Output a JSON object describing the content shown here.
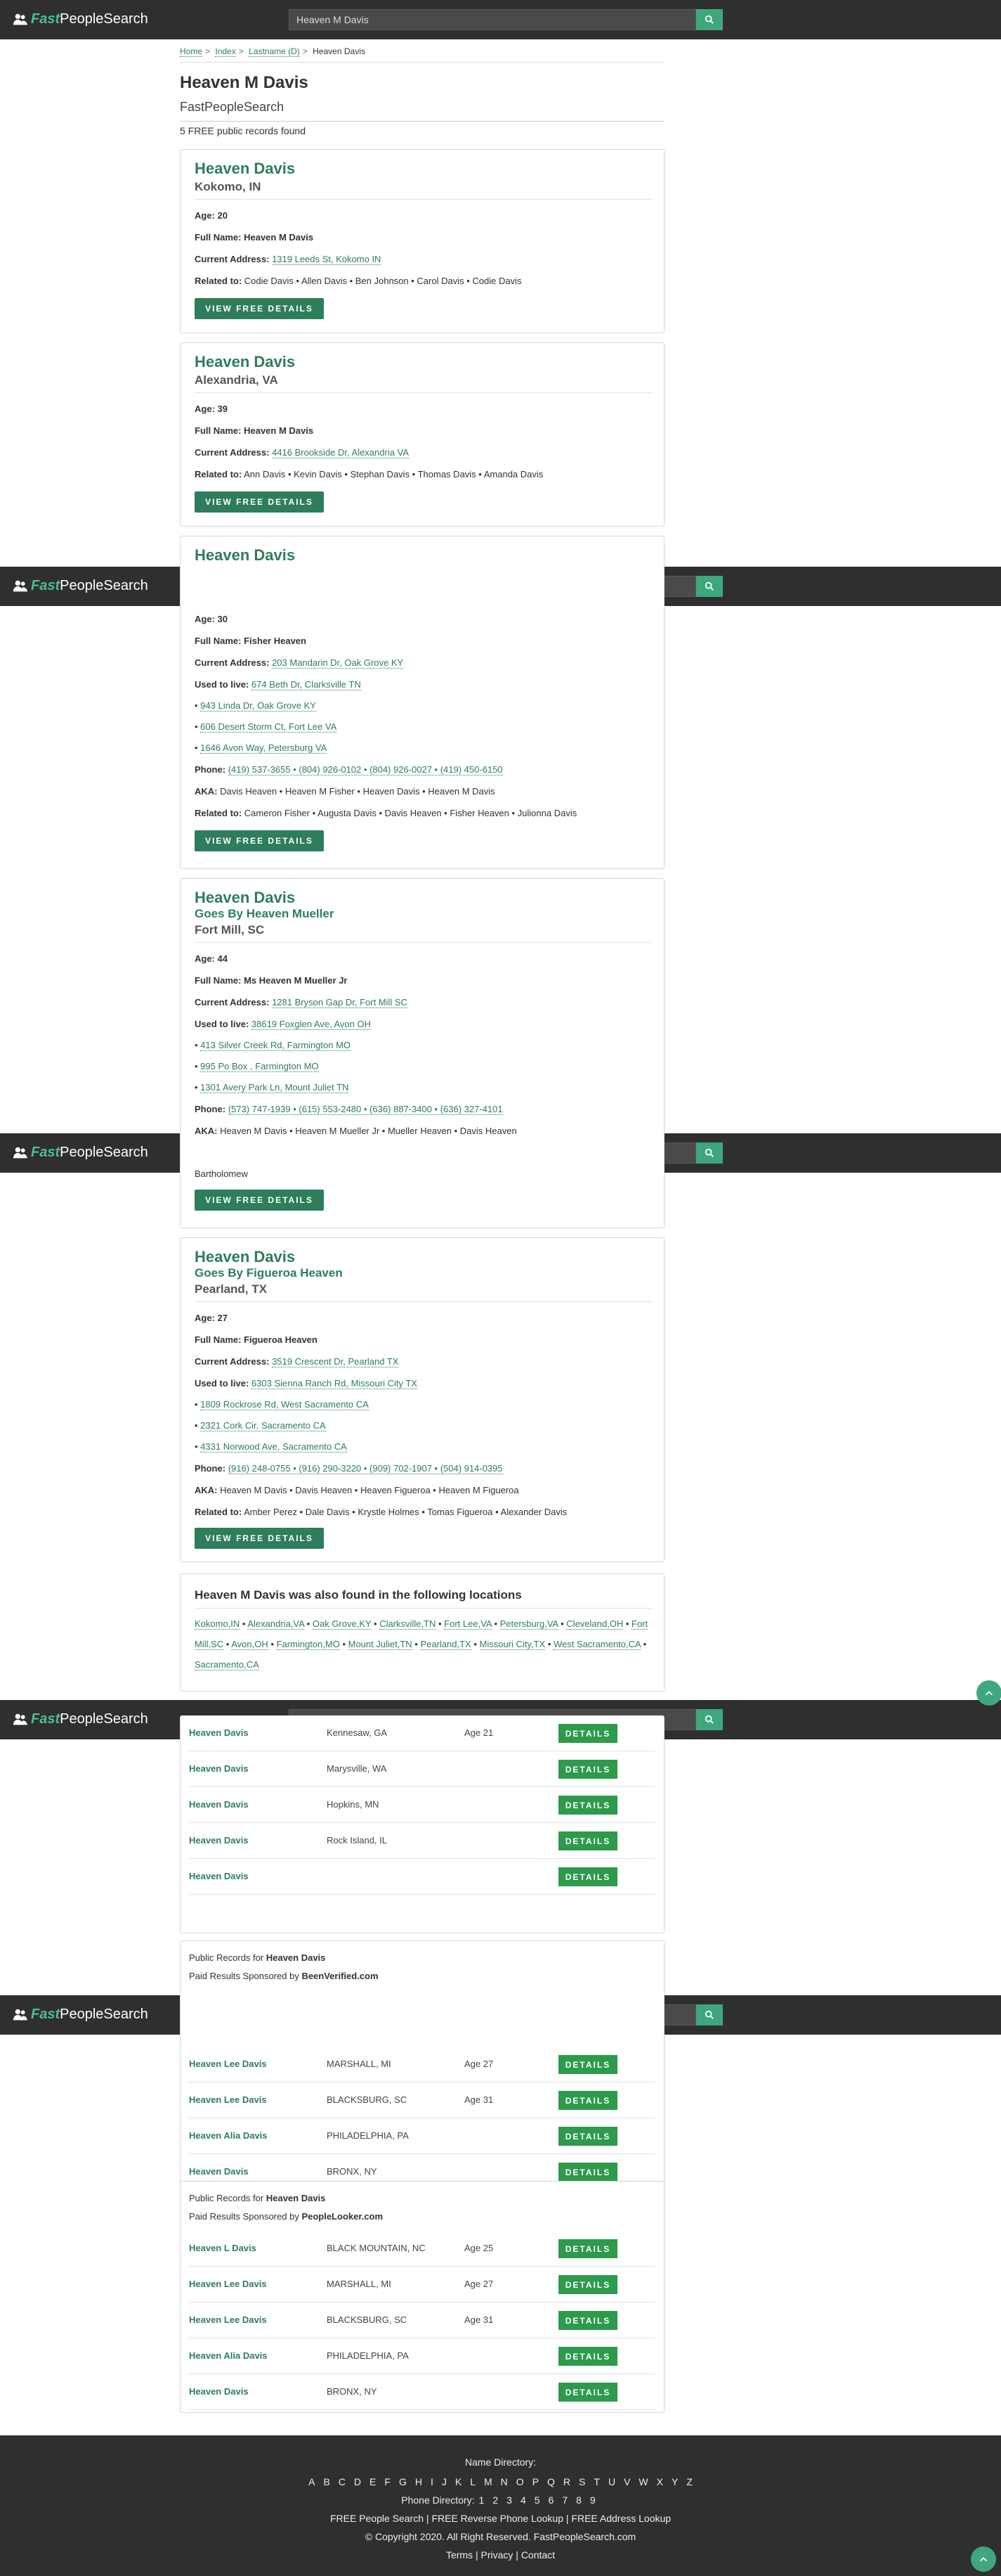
{
  "header": {
    "logo_fast": "Fast",
    "logo_rest": "PeopleSearch",
    "search_value": "Heaven M Davis"
  },
  "breadcrumb": [
    "Home",
    "Index",
    "Lastname (D)",
    "Heaven Davis"
  ],
  "page_title": "Heaven M Davis",
  "subtitle": "FastPeopleSearch",
  "result_count": "5 FREE public records found",
  "labels": {
    "age": "Age:",
    "full_name": "Full Name:",
    "current_address": "Current Address:",
    "used_to_live": "Used to live:",
    "phone": "Phone:",
    "aka": "AKA:",
    "related_to": "Related to:",
    "goes_by": "Goes By",
    "view_button": "VIEW FREE DETAILS",
    "details_button": "DETAILS"
  },
  "records": [
    {
      "name": "Heaven Davis",
      "location": "Kokomo, IN",
      "age": "20",
      "full_name": "Heaven M Davis",
      "current_address": "1319 Leeds St, Kokomo IN",
      "related": "Codie Davis • Allen Davis • Ben Johnson • Carol Davis • Codie Davis"
    },
    {
      "name": "Heaven Davis",
      "location": "Alexandria, VA",
      "age": "39",
      "full_name": "Heaven M Davis",
      "current_address": "4416 Brookside Dr, Alexandria VA",
      "related": "Ann Davis • Kevin Davis • Stephan Davis • Thomas Davis • Amanda Davis"
    },
    {
      "name": "Heaven Davis",
      "age": "30",
      "full_name": "Fisher Heaven",
      "current_address": "203 Mandarin Dr, Oak Grove KY",
      "used_to_live": [
        "674 Beth Dr, Clarksville TN",
        "943 Linda Dr, Oak Grove KY",
        "606 Desert Storm Ct, Fort Lee VA",
        "1646 Avon Way, Petersburg VA"
      ],
      "phones": "(419) 537-3655 • (804) 926-0102 • (804) 926-0027 • (419) 450-6150",
      "aka": "Davis Heaven • Heaven M Fisher • Heaven Davis • Heaven M Davis",
      "related": "Cameron Fisher • Augusta Davis • Davis Heaven • Fisher Heaven • Julionna Davis"
    },
    {
      "name": "Heaven Davis",
      "goes_by": "Heaven Mueller",
      "location": "Fort Mill, SC",
      "age": "44",
      "full_name": "Ms Heaven M Mueller Jr",
      "current_address": "1281 Bryson Gap Dr, Fort Mill SC",
      "used_to_live": [
        "38619 Foxglen Ave, Avon OH",
        "413 Silver Creek Rd, Farmington MO",
        "995 Po Box , Farmington MO",
        "1301 Avery Park Ln, Mount Juliet TN"
      ],
      "phones": "(573) 747-1939 • (615) 553-2480 • (636) 887-3400 • (636) 327-4101",
      "aka": "Heaven M Davis • Heaven M Mueller Jr • Mueller Heaven • Davis Heaven",
      "related_tail": "Bartholomew"
    },
    {
      "name": "Heaven Davis",
      "goes_by": "Figueroa Heaven",
      "location": "Pearland, TX",
      "age": "27",
      "full_name": "Figueroa Heaven",
      "current_address": "3519 Crescent Dr, Pearland TX",
      "used_to_live": [
        "6303 Sienna Ranch Rd, Missouri City TX",
        "1809 Rockrose Rd, West Sacramento CA",
        "2321 Cork Cir, Sacramento CA",
        "4331 Norwood Ave, Sacramento CA"
      ],
      "phones": "(916) 248-0755 • (916) 290-3220 • (909) 702-1907 • (504) 914-0395",
      "aka": "Heaven M Davis • Davis Heaven • Heaven Figueroa • Heaven M Figueroa",
      "related": "Amber Perez • Dale Davis • Krystle Holmes • Tomas Figueroa • Alexander Davis"
    }
  ],
  "locations": {
    "title": "Heaven M Davis was also found in the following locations",
    "items": [
      "Kokomo,IN",
      "Alexandria,VA",
      "Oak Grove,KY",
      "Clarksville,TN",
      "Fort Lee,VA",
      "Petersburg,VA",
      "Cleveland,OH",
      "Fort Mill,SC",
      "Avon,OH",
      "Farmington,MO",
      "Mount Juliet,TN",
      "Pearland,TX",
      "Missouri City,TX",
      "West Sacramento,CA",
      "Sacramento,CA"
    ]
  },
  "table1": [
    {
      "name": "Heaven Davis",
      "city": "Kennesaw, GA",
      "age": "Age 21"
    },
    {
      "name": "Heaven Davis",
      "city": "Marysville, WA",
      "age": ""
    },
    {
      "name": "Heaven Davis",
      "city": "Hopkins, MN",
      "age": ""
    },
    {
      "name": "Heaven Davis",
      "city": "Rock Island, IL",
      "age": ""
    },
    {
      "name": "Heaven Davis",
      "city": "",
      "age": ""
    }
  ],
  "sponsor1": {
    "line1_prefix": "Public Records for",
    "line1_name": "Heaven Davis",
    "line2_prefix": "Paid Results Sponsored by",
    "line2_name": "BeenVerified.com"
  },
  "table2": [
    {
      "name": "Heaven Lee Davis",
      "city": "MARSHALL, MI",
      "age": "Age 27"
    },
    {
      "name": "Heaven Lee Davis",
      "city": "BLACKSBURG, SC",
      "age": "Age 31"
    },
    {
      "name": "Heaven Alia Davis",
      "city": "PHILADELPHIA, PA",
      "age": ""
    },
    {
      "name": "Heaven Davis",
      "city": "BRONX, NY",
      "age": ""
    }
  ],
  "sponsor2": {
    "line1_prefix": "Public Records for",
    "line1_name": "Heaven Davis",
    "line2_prefix": "Paid Results Sponsored by",
    "line2_name": "PeopleLooker.com"
  },
  "table3": [
    {
      "name": "Heaven L Davis",
      "city": "BLACK MOUNTAIN, NC",
      "age": "Age 25"
    },
    {
      "name": "Heaven Lee Davis",
      "city": "MARSHALL, MI",
      "age": "Age 27"
    },
    {
      "name": "Heaven Lee Davis",
      "city": "BLACKSBURG, SC",
      "age": "Age 31"
    },
    {
      "name": "Heaven Alia Davis",
      "city": "PHILADELPHIA, PA",
      "age": ""
    },
    {
      "name": "Heaven Davis",
      "city": "BRONX, NY",
      "age": ""
    }
  ],
  "footer": {
    "name_directory": "Name Directory:",
    "letters": [
      "A",
      "B",
      "C",
      "D",
      "E",
      "F",
      "G",
      "H",
      "I",
      "J",
      "K",
      "L",
      "M",
      "N",
      "O",
      "P",
      "Q",
      "R",
      "S",
      "T",
      "U",
      "V",
      "W",
      "X",
      "Y",
      "Z"
    ],
    "phone_directory": "Phone Directory:",
    "digits": [
      "1",
      "2",
      "3",
      "4",
      "5",
      "6",
      "7",
      "8",
      "9"
    ],
    "services": [
      "FREE People Search",
      "FREE Reverse Phone Lookup",
      "FREE Address Lookup"
    ],
    "copyright": "© Copyright 2020. All Right Reserved. FastPeopleSearch.com",
    "legal": [
      "Terms",
      "Privacy",
      "Contact"
    ]
  },
  "colors": {
    "brand_green": "#2e7d5b",
    "logo_green": "#4cbf8f",
    "topbar": "#2f2f2f",
    "button_green": "#2e9a4b"
  }
}
